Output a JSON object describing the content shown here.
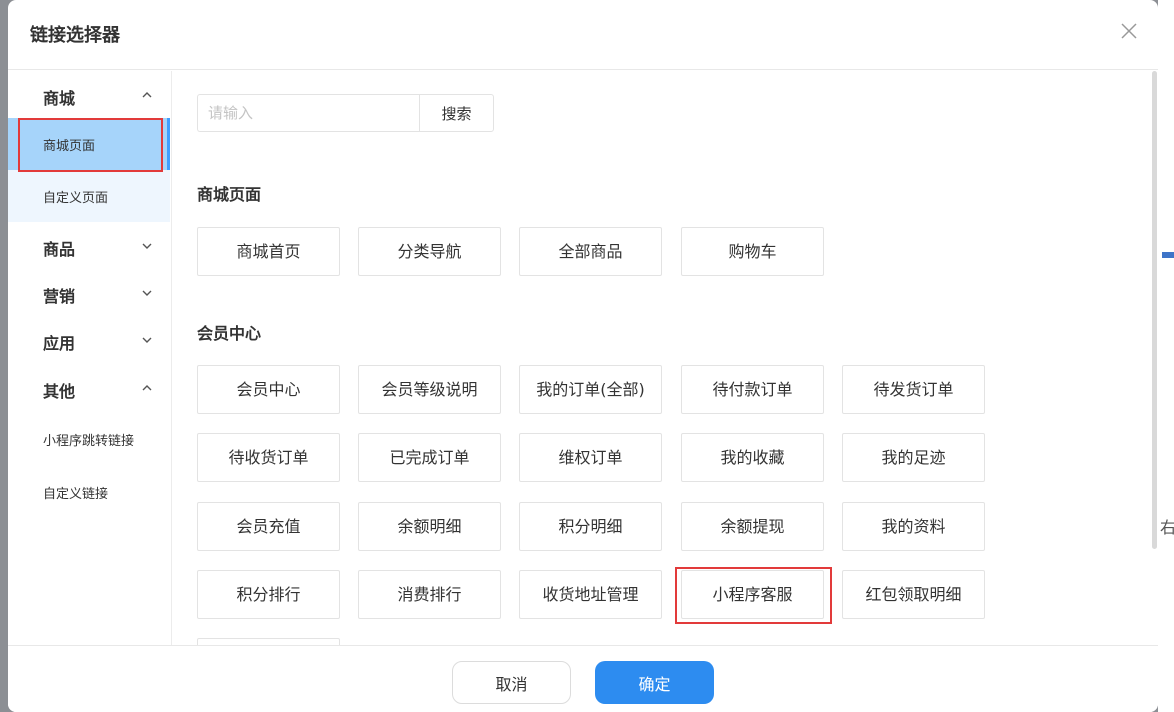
{
  "dialog": {
    "title": "链接选择器",
    "close_icon": "close-icon"
  },
  "sidebar": {
    "groups": [
      {
        "label": "商城",
        "expanded": true,
        "items": [
          "商城页面",
          "自定义页面"
        ]
      },
      {
        "label": "商品",
        "expanded": false
      },
      {
        "label": "营销",
        "expanded": false
      },
      {
        "label": "应用",
        "expanded": false
      },
      {
        "label": "其他",
        "expanded": true,
        "items": [
          "小程序跳转链接",
          "自定义链接"
        ]
      }
    ],
    "active_item": "商城页面"
  },
  "search": {
    "placeholder": "请输入",
    "value": "",
    "button_label": "搜索"
  },
  "sections": [
    {
      "title": "商城页面",
      "links": [
        "商城首页",
        "分类导航",
        "全部商品",
        "购物车"
      ]
    },
    {
      "title": "会员中心",
      "links": [
        "会员中心",
        "会员等级说明",
        "我的订单(全部)",
        "待付款订单",
        "待发货订单",
        "待收货订单",
        "已完成订单",
        "维权订单",
        "我的收藏",
        "我的足迹",
        "会员充值",
        "余额明细",
        "积分明细",
        "余额提现",
        "我的资料",
        "积分排行",
        "消费排行",
        "收货地址管理",
        "小程序客服",
        "红包领取明细"
      ],
      "highlighted": "小程序客服"
    }
  ],
  "footer": {
    "cancel_label": "取消",
    "confirm_label": "确定"
  },
  "background": {
    "side_text": "右"
  },
  "colors": {
    "primary": "#2d8cf0",
    "active_bg": "#a6d4fa",
    "sub_bg": "#eef6fe",
    "annotation_red": "#e23a3a"
  }
}
